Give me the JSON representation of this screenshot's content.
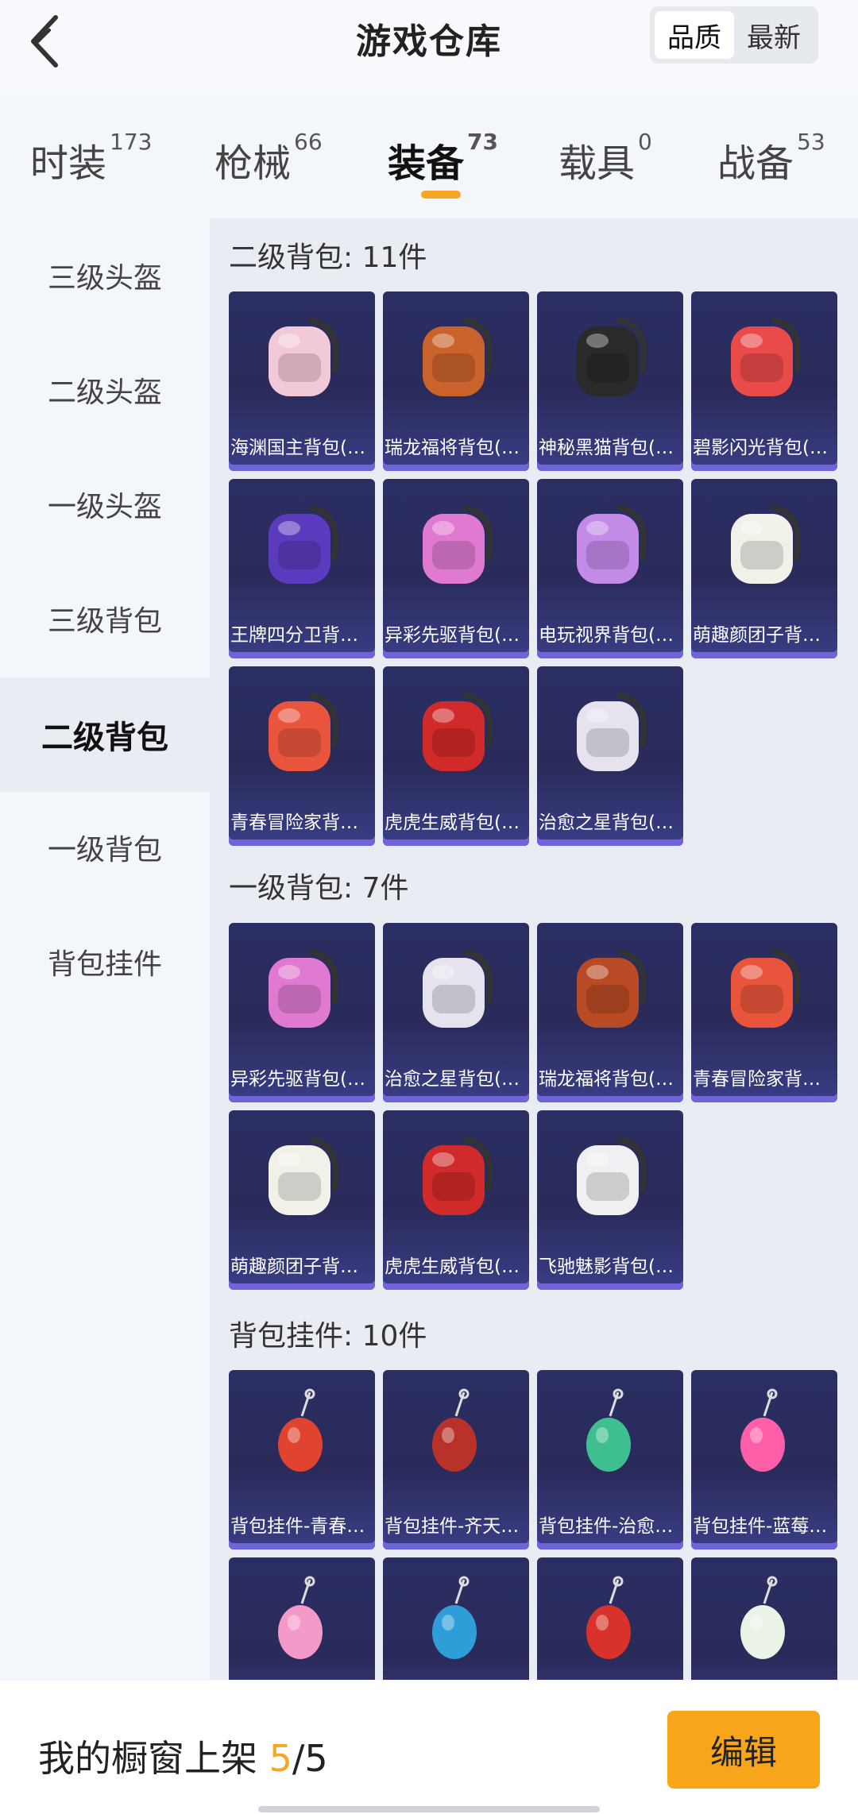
{
  "header": {
    "title": "游戏仓库",
    "sort_options": [
      "品质",
      "最新"
    ],
    "active_sort": "品质"
  },
  "tabs": [
    {
      "label": "时装",
      "count": "173"
    },
    {
      "label": "枪械",
      "count": "66"
    },
    {
      "label": "装备",
      "count": "73"
    },
    {
      "label": "载具",
      "count": "0"
    },
    {
      "label": "战备",
      "count": "53"
    }
  ],
  "active_tab": "装备",
  "sidebar": [
    "三级头盔",
    "二级头盔",
    "一级头盔",
    "三级背包",
    "二级背包",
    "一级背包",
    "背包挂件"
  ],
  "active_sidebar": "二级背包",
  "sections": [
    {
      "title": "二级背包: 11件",
      "items": [
        {
          "name": "海渊国主背包(…",
          "icon": "backpack-pink-white-icon",
          "color": "#f2c9d8"
        },
        {
          "name": "瑞龙福将背包(…",
          "icon": "backpack-dragon-orange-icon",
          "color": "#c9622b"
        },
        {
          "name": "神秘黑猫背包(…",
          "icon": "backpack-black-cat-icon",
          "color": "#2a2a2a"
        },
        {
          "name": "碧影闪光背包(…",
          "icon": "backpack-gamepad-icon",
          "color": "#e94b4b"
        },
        {
          "name": "王牌四分卫背…",
          "icon": "backpack-helmet-purple-icon",
          "color": "#5b3bbd"
        },
        {
          "name": "异彩先驱背包(…",
          "icon": "backpack-pink-bunny-icon",
          "color": "#e07ad0"
        },
        {
          "name": "电玩视界背包(…",
          "icon": "backpack-arcade-icon",
          "color": "#c48ae8"
        },
        {
          "name": "萌趣颜团子背…",
          "icon": "backpack-rice-ball-icon",
          "color": "#f1f1ea"
        },
        {
          "name": "青春冒险家背…",
          "icon": "backpack-red-dino-icon",
          "color": "#e8553c"
        },
        {
          "name": "虎虎生威背包(…",
          "icon": "backpack-tiger-red-icon",
          "color": "#d12a2a"
        },
        {
          "name": "治愈之星背包(…",
          "icon": "backpack-white-star-icon",
          "color": "#e6e2ee"
        }
      ]
    },
    {
      "title": "一级背包: 7件",
      "items": [
        {
          "name": "异彩先驱背包(…",
          "icon": "backpack-pink-bunny-icon",
          "color": "#e07ad0"
        },
        {
          "name": "治愈之星背包(…",
          "icon": "backpack-white-star-icon",
          "color": "#e6e2ee"
        },
        {
          "name": "瑞龙福将背包(…",
          "icon": "backpack-dragon-orange-icon",
          "color": "#b84a25"
        },
        {
          "name": "青春冒险家背…",
          "icon": "backpack-red-dino-icon",
          "color": "#e8553c"
        },
        {
          "name": "萌趣颜团子背…",
          "icon": "backpack-rice-ball-icon",
          "color": "#f1f1ea"
        },
        {
          "name": "虎虎生威背包(…",
          "icon": "backpack-tiger-red-icon",
          "color": "#d12a2a"
        },
        {
          "name": "飞驰魅影背包(…",
          "icon": "backpack-white-sport-icon",
          "color": "#f0f0f2"
        }
      ]
    },
    {
      "title": "背包挂件: 10件",
      "items": [
        {
          "name": "背包挂件-青春…",
          "icon": "charm-red-dino-icon",
          "color": "#e0442f"
        },
        {
          "name": "背包挂件-齐天…",
          "icon": "charm-sword-icon",
          "color": "#b8322a"
        },
        {
          "name": "背包挂件-治愈…",
          "icon": "charm-capsule-icon",
          "color": "#3fbf8f"
        },
        {
          "name": "背包挂件-蓝莓…",
          "icon": "charm-ice-cream-icon",
          "color": "#ff5fa8"
        },
        {
          "name": "",
          "icon": "charm-roller-skate-icon",
          "color": "#f39ac8"
        },
        {
          "name": "",
          "icon": "charm-lantern-icon",
          "color": "#2f9ed8"
        },
        {
          "name": "",
          "icon": "charm-red-tag-icon",
          "color": "#d8322a"
        },
        {
          "name": "",
          "icon": "charm-green-sprout-icon",
          "color": "#eaf3e6"
        }
      ]
    }
  ],
  "bottom_bar": {
    "label": "我的橱窗上架",
    "current": "5",
    "total": "/5",
    "edit_label": "编辑"
  }
}
